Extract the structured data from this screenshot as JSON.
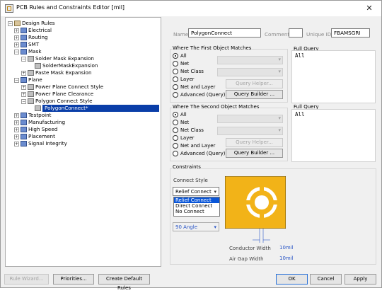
{
  "window": {
    "title": "PCB Rules and Constraints Editor [mil]",
    "close_glyph": "✕"
  },
  "tree": {
    "items": [
      {
        "label": "Design Rules",
        "expander": "−",
        "icon": "folder-icon"
      },
      {
        "label": "Electrical",
        "expander": "+",
        "icon": "rule-icon"
      },
      {
        "label": "Routing",
        "expander": "+",
        "icon": "rule-icon"
      },
      {
        "label": "SMT",
        "expander": "+",
        "icon": "rule-icon"
      },
      {
        "label": "Mask",
        "expander": "−",
        "icon": "rule-icon"
      },
      {
        "label": "Solder Mask Expansion",
        "expander": "−",
        "icon": "gray-icon"
      },
      {
        "label": "SolderMaskExpansion",
        "expander": "",
        "icon": "gray-icon"
      },
      {
        "label": "Paste Mask Expansion",
        "expander": "+",
        "icon": "gray-icon"
      },
      {
        "label": "Plane",
        "expander": "−",
        "icon": "rule-icon"
      },
      {
        "label": "Power Plane Connect Style",
        "expander": "+",
        "icon": "gray-icon"
      },
      {
        "label": "Power Plane Clearance",
        "expander": "+",
        "icon": "gray-icon"
      },
      {
        "label": "Polygon Connect Style",
        "expander": "−",
        "icon": "gray-icon"
      },
      {
        "label": "PolygonConnect*",
        "expander": "",
        "icon": "gray-icon"
      },
      {
        "label": "Testpoint",
        "expander": "+",
        "icon": "rule-icon"
      },
      {
        "label": "Manufacturing",
        "expander": "+",
        "icon": "rule-icon"
      },
      {
        "label": "High Speed",
        "expander": "+",
        "icon": "rule-icon"
      },
      {
        "label": "Placement",
        "expander": "+",
        "icon": "rule-icon"
      },
      {
        "label": "Signal Integrity",
        "expander": "+",
        "icon": "rule-icon"
      }
    ]
  },
  "header": {
    "name_label": "Name",
    "name_value": "PolygonConnect",
    "comment_label": "Comment",
    "comment_value": "",
    "uid_label": "Unique ID",
    "uid_value": "FBAMSGRI"
  },
  "first_match": {
    "title": "Where The First Object Matches",
    "options": [
      "All",
      "Net",
      "Net Class",
      "Layer",
      "Net and Layer",
      "Advanced (Query)"
    ],
    "selected": "All",
    "query_helper_label": "Query Helper...",
    "query_builder_label": "Query Builder ...",
    "full_query_title": "Full Query",
    "full_query": "All"
  },
  "second_match": {
    "title": "Where The Second Object Matches",
    "options": [
      "All",
      "Net",
      "Net Class",
      "Layer",
      "Net and Layer",
      "Advanced (Query)"
    ],
    "selected": "All",
    "query_helper_label": "Query Helper...",
    "query_builder_label": "Query Builder ...",
    "full_query_title": "Full Query",
    "full_query": "All"
  },
  "constraints": {
    "title": "Constraints",
    "connect_style_label": "Connect Style",
    "connect_style_value": "Relief Connect",
    "connect_style_options": [
      "Relief Connect",
      "Direct Connect",
      "No Connect"
    ],
    "angle_value": "90 Angle",
    "conductor_width_label": "Conductor Width",
    "conductor_width_value": "10mil",
    "air_gap_label": "Air Gap Width",
    "air_gap_value": "10mil",
    "colors": {
      "pad": "#f2b318",
      "highlight": "#0a56d8"
    }
  },
  "footer": {
    "rule_wizard": "Rule Wizard...",
    "priorities": "Priorities...",
    "create_default": "Create Default Rules",
    "ok": "OK",
    "cancel": "Cancel",
    "apply": "Apply"
  }
}
